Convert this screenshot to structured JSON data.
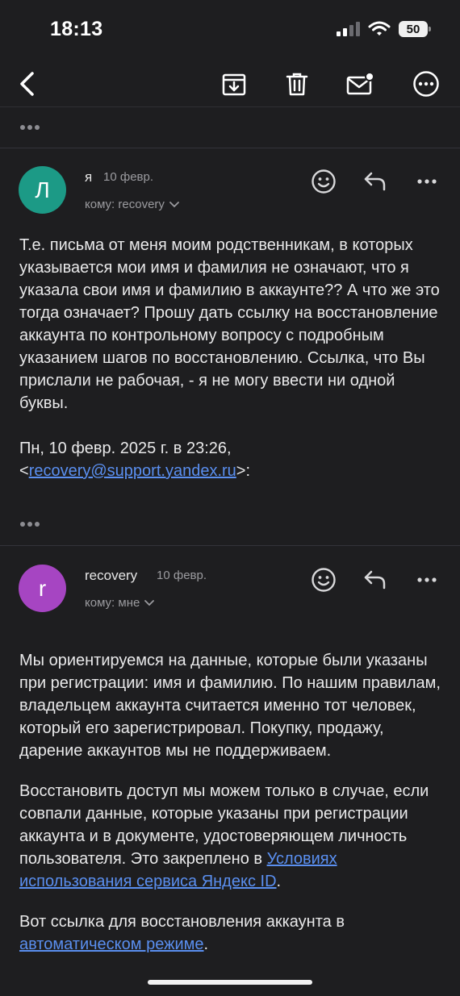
{
  "status": {
    "time": "18:13",
    "battery": "50"
  },
  "toolbar": {
    "back_icon": "chevron-left-icon",
    "archive_icon": "archive-download-icon",
    "delete_icon": "trash-icon",
    "unread_icon": "mail-unread-icon",
    "more_icon": "more-circle-icon"
  },
  "messages": [
    {
      "avatar_letter": "Л",
      "avatar_color": "#1c9a86",
      "sender": "я",
      "date": "10 февр.",
      "to": "кому: recovery",
      "body": "Т.е. письма от меня моим родственникам, в которых указывается мои имя и фамилия не означают, что я указала свои имя и фамилию в аккаунте?? А что же это тогда означает? Прошу дать ссылку на восстановление аккаунта по контрольному вопросу с подробным указанием шагов по восстановлению. Ссылка, что Вы прислали не рабочая, - я не могу ввести ни одной буквы.",
      "quote_intro": "Пн, 10 февр. 2025 г. в 23:26,",
      "quote_lt": "<",
      "quote_email": "recovery@support.yandex.ru",
      "quote_gt": ">:"
    },
    {
      "avatar_letter": "r",
      "avatar_color": "#a645c2",
      "sender": "recovery",
      "date": "10 февр.",
      "to": "кому: мне",
      "p1": "Мы ориентируемся на данные, которые были указаны при регистрации: имя и фамилию. По нашим правилам, владельцем аккаунта считается именно тот человек, который его зарегистрировал. Покупку, продажу, дарение аккаунтов мы не поддерживаем.",
      "p2_pre": "Восстановить доступ мы можем только в случае, если совпали данные, которые указаны при регистрации аккаунта и в документе, удостоверяющем личность пользователя. Это закреплено в ",
      "p2_link": "Условиях использования сервиса Яндекс ID",
      "p2_post": ".",
      "p3_pre": "Вот ссылка для восстановления аккаунта в ",
      "p3_link": "автоматическом режиме",
      "p3_post": "."
    }
  ]
}
